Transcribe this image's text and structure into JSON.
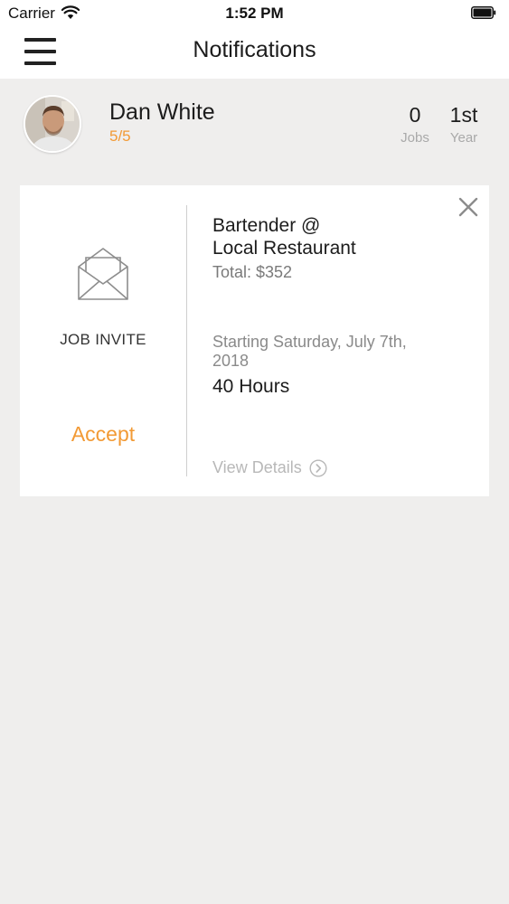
{
  "status_bar": {
    "carrier": "Carrier",
    "time": "1:52 PM"
  },
  "nav": {
    "title": "Notifications"
  },
  "profile": {
    "name": "Dan White",
    "rating": "5/5",
    "stats": [
      {
        "value": "0",
        "label": "Jobs"
      },
      {
        "value": "1st",
        "label": "Year"
      }
    ]
  },
  "card": {
    "type_label": "JOB INVITE",
    "accept_label": "Accept",
    "title_line1": "Bartender @",
    "title_line2": "Local Restaurant",
    "total": "Total: $352",
    "start": "Starting Saturday, July 7th, 2018",
    "hours": "40 Hours",
    "view_details": "View Details"
  },
  "colors": {
    "accent": "#f29a35",
    "background": "#efeeed",
    "card": "#ffffff"
  },
  "icons": {
    "menu": "hamburger-menu-icon",
    "close": "close-icon",
    "envelope": "envelope-open-icon",
    "chevron": "chevron-right-circle-icon",
    "wifi": "wifi-icon",
    "battery": "battery-icon"
  }
}
